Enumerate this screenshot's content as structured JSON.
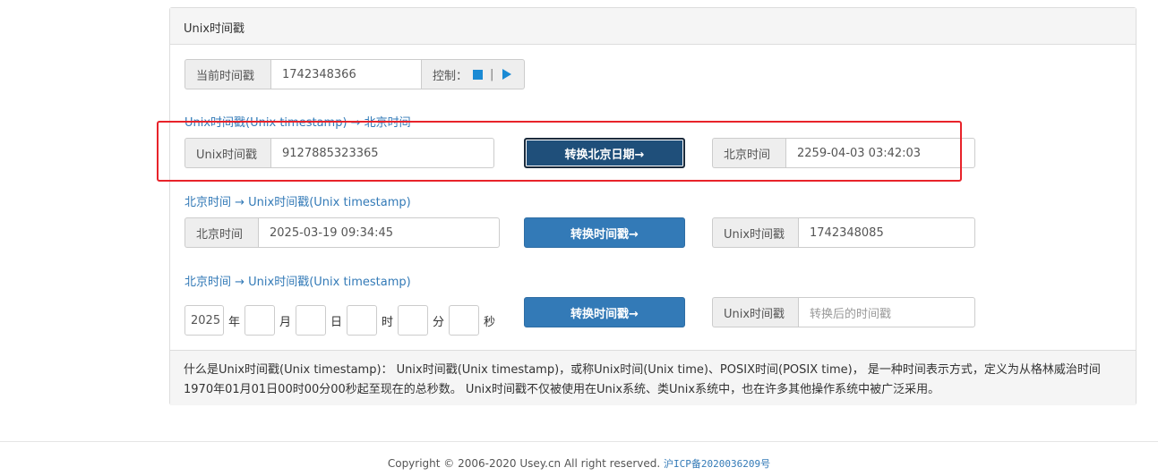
{
  "panel": {
    "title": "Unix时间戳",
    "current": {
      "label": "当前时间戳",
      "value": "1742348366",
      "control_label": "控制：",
      "control_sep": "|",
      "stop_icon": "stop-icon",
      "play_icon": "play-icon"
    },
    "section1": {
      "title": "Unix时间戳(Unix timestamp) → 北京时间",
      "input_label": "Unix时间戳",
      "input_value": "9127885323365",
      "button": "转换北京日期→",
      "output_label": "北京时间",
      "output_value": "2259-04-03 03:42:03"
    },
    "section2": {
      "title": "北京时间 → Unix时间戳(Unix timestamp)",
      "input_label": "北京时间",
      "input_value": "2025-03-19 09:34:45",
      "button": "转换时间戳→",
      "output_label": "Unix时间戳",
      "output_value": "1742348085"
    },
    "section3": {
      "title": "北京时间 → Unix时间戳(Unix timestamp)",
      "year_value": "2025",
      "year_unit": "年",
      "month_unit": "月",
      "day_unit": "日",
      "hour_unit": "时",
      "minute_unit": "分",
      "second_unit": "秒",
      "button": "转换时间戳→",
      "output_label": "Unix时间戳",
      "output_placeholder": "转换后的时间戳"
    },
    "footer_text_line1": "什么是Unix时间戳(Unix timestamp)： Unix时间戳(Unix timestamp)，或称Unix时间(Unix time)、POSIX时间(POSIX time)， 是一种时间表示方式，定义为从格林威治时间",
    "footer_text_line2": "1970年01月01日00时00分00秒起至现在的总秒数。 Unix时间戳不仅被使用在Unix系统、类Unix系统中，也在许多其他操作系统中被广泛采用。"
  },
  "site_footer": {
    "copyright": "Copyright © 2006-2020 Usey.cn All right reserved.",
    "icp": "沪ICP备2020036209号"
  },
  "colors": {
    "accent": "#337ab7",
    "highlight_border": "#e8232a",
    "control_icon": "#1a8ad4"
  }
}
